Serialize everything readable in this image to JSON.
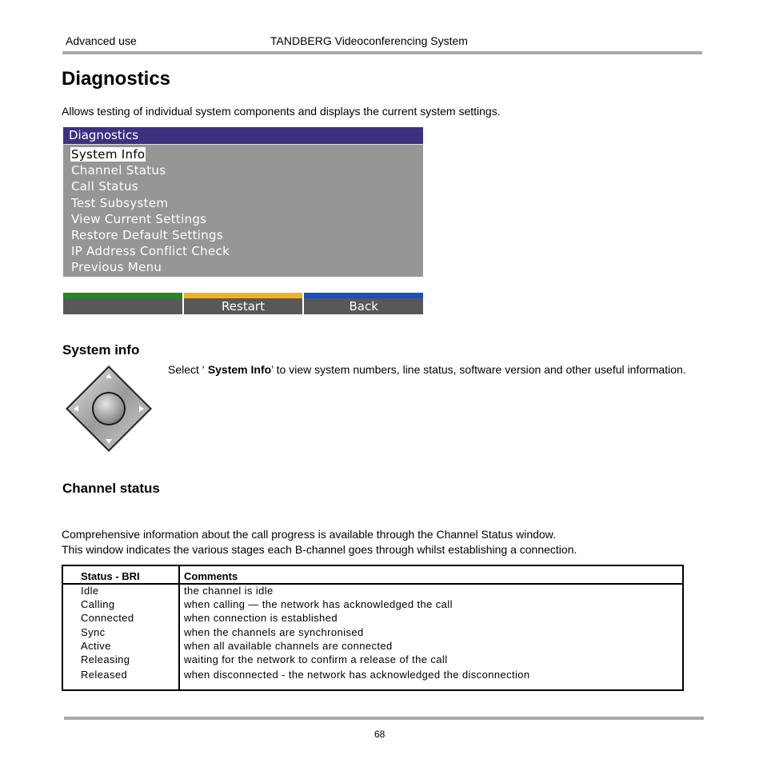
{
  "header": {
    "section": "Advanced use",
    "product": "TANDBERG Videoconferencing System"
  },
  "page_title": "Diagnostics",
  "intro": "Allows testing of individual system components and displays the current system settings.",
  "osd_menu": {
    "title": "Diagnostics",
    "items": [
      {
        "label": "System Info",
        "selected": true
      },
      {
        "label": "Channel Status",
        "selected": false
      },
      {
        "label": "Call Status",
        "selected": false
      },
      {
        "label": "Test Subsystem",
        "selected": false
      },
      {
        "label": "View Current Settings",
        "selected": false
      },
      {
        "label": "Restore Default Settings",
        "selected": false
      },
      {
        "label": "IP Address Conflict Check",
        "selected": false
      },
      {
        "label": "Previous Menu",
        "selected": false
      }
    ],
    "colors": {
      "title_bg": "#3e2f7f",
      "body_bg": "#959695"
    }
  },
  "softkeys": [
    {
      "label": "",
      "color": "#1f8a1f"
    },
    {
      "label": "Restart",
      "color": "#f5b01a"
    },
    {
      "label": "Back",
      "color": "#1a4fc4"
    }
  ],
  "system_info": {
    "heading": "System info",
    "icon": "navigation-pad-icon",
    "text_prefix": "Select ‘ ",
    "text_bold": "System Info",
    "text_suffix": "’ to view system numbers, line status, software version and other useful information."
  },
  "channel_status": {
    "heading": "Channel status",
    "paragraph_1": "Comprehensive information about the call progress is available through the Channel Status window.",
    "paragraph_2": "This window indicates the various stages each B-channel goes through whilst establishing a connection."
  },
  "status_table": {
    "headers": [
      "Status - BRI",
      "Comments"
    ],
    "rows": [
      [
        "Idle",
        "the channel is idle"
      ],
      [
        "Calling",
        "when calling — the network has acknowledged the call"
      ],
      [
        "Connected",
        "when connection is established"
      ],
      [
        "Sync",
        "when the channels are synchronised"
      ],
      [
        "Active",
        "when all available channels are connected"
      ],
      [
        "Releasing",
        "waiting for the network to confirm a release of the call"
      ],
      [
        "Released",
        "when disconnected - the network has acknowledged the disconnection"
      ]
    ]
  },
  "footer": {
    "page_number": "68"
  }
}
